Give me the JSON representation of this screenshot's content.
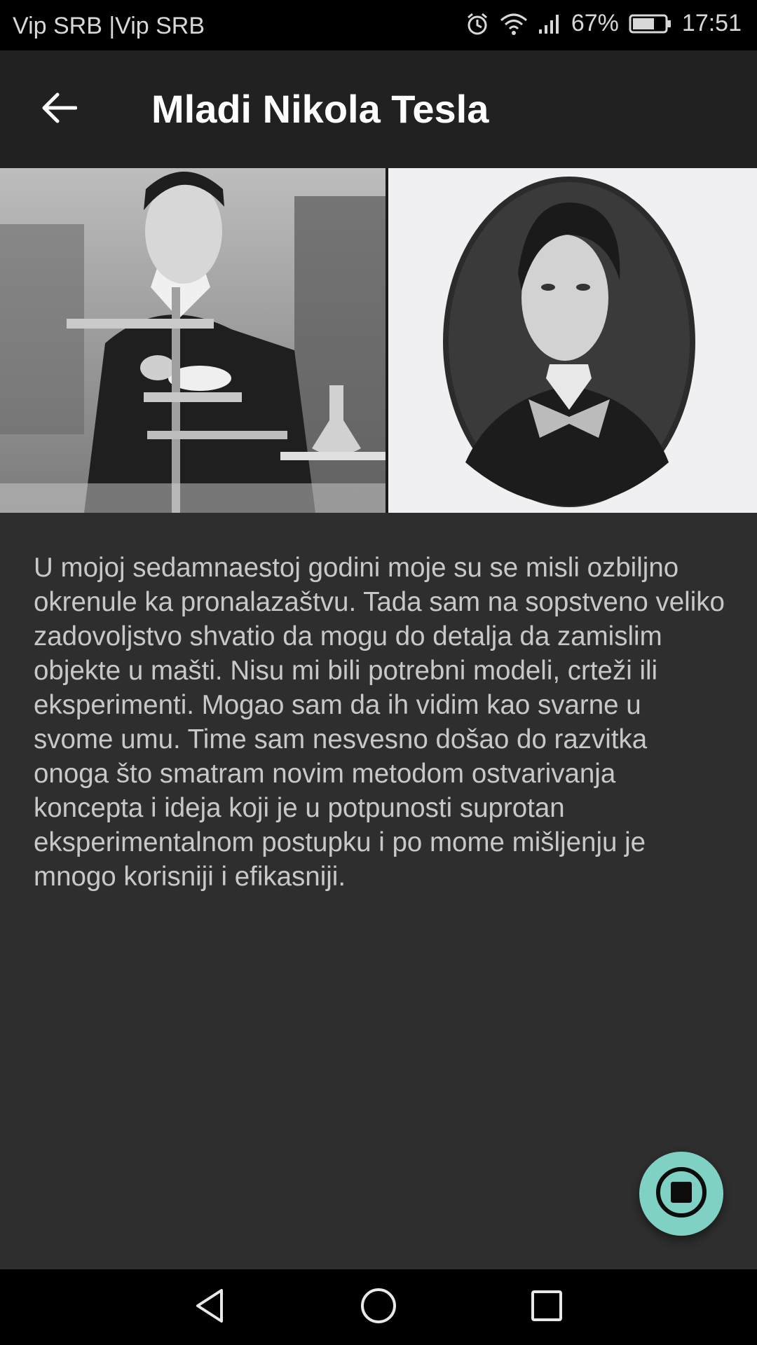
{
  "status_bar": {
    "carrier": "Vip SRB |Vip SRB",
    "battery": "67%",
    "time": "17:51",
    "icons": [
      "alarm-icon",
      "wifi-icon",
      "signal-icon",
      "battery-icon"
    ]
  },
  "app_bar": {
    "title": "Mladi Nikola Tesla",
    "back_icon": "arrow-left-icon"
  },
  "photos": [
    {
      "name": "young-tesla-lab-photo"
    },
    {
      "name": "young-tesla-portrait-photo"
    }
  ],
  "content": {
    "paragraph": "U mojoj sedamnaestoj godini moje su se misli ozbiljno okrenule ka pronalazaštvu. Tada sam na sopstveno veliko zadovoljstvo shvatio da mogu do detalja da zamislim objekte u mašti. Nisu mi bili potrebni modeli, crteži ili eksperimenti. Mogao sam da ih vidim kao svarne u svome umu. Time sam nesvesno došao do razvitka onoga što smatram novim metodom ostvarivanja koncepta i ideja koji je u potpunosti suprotan eksperimentalnom postupku i po mome mišljenju je mnogo korisniji i efikasniji."
  },
  "fab": {
    "icon": "stop-icon",
    "color": "#7fd1c3"
  },
  "nav_bar": {
    "items": [
      "back-triangle-icon",
      "home-circle-icon",
      "recents-square-icon"
    ]
  },
  "colors": {
    "background": "#2e2e2e",
    "app_bar": "#212121",
    "text": "#c8c8c8",
    "accent": "#7fd1c3"
  }
}
